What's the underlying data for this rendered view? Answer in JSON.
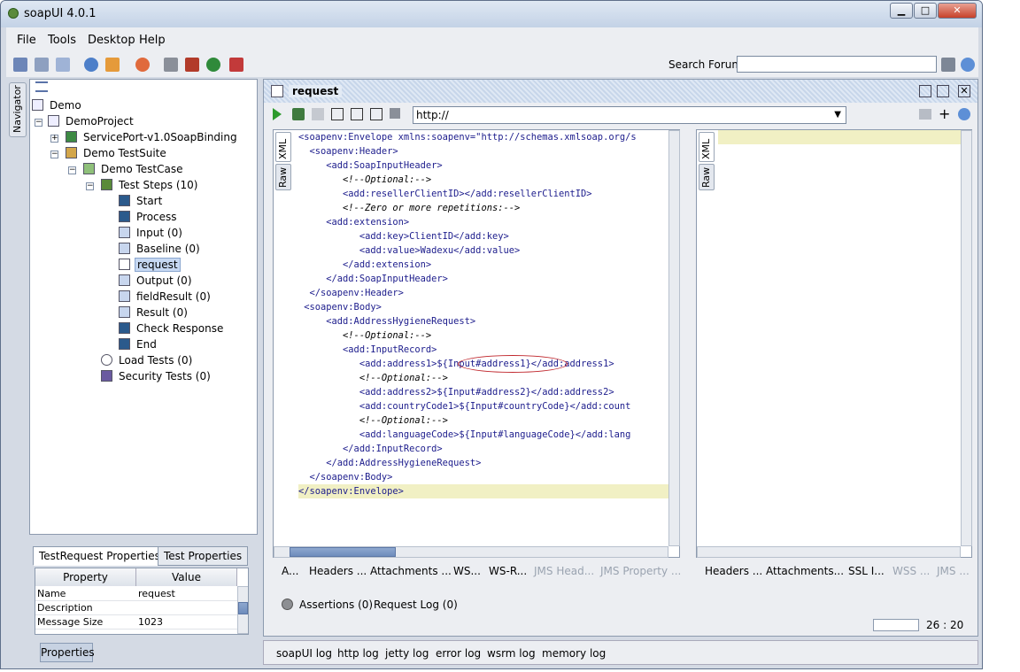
{
  "window": {
    "title": "soapUI 4.0.1",
    "min": "▁",
    "max": "□",
    "close": "✕"
  },
  "menu": [
    "File",
    "Tools",
    "Desktop",
    "Help"
  ],
  "toolbar": {
    "search_label": "Search Forum",
    "search_value": ""
  },
  "navigator_tab": "Navigator",
  "tree": [
    {
      "label": "Demo",
      "icon": "workspace-icon"
    },
    {
      "label": "DemoProject",
      "icon": "project-icon"
    },
    {
      "label": "ServicePort-v1.0SoapBinding",
      "icon": "interface-icon"
    },
    {
      "label": "Demo TestSuite",
      "icon": "testsuite-icon"
    },
    {
      "label": "Demo TestCase",
      "icon": "testcase-icon"
    },
    {
      "label": "Test Steps (10)",
      "icon": "teststeps-icon"
    },
    {
      "label": "Start",
      "icon": "star-icon"
    },
    {
      "label": "Process",
      "icon": "star-icon"
    },
    {
      "label": "Input (0)",
      "icon": "datasource-icon"
    },
    {
      "label": "Baseline (0)",
      "icon": "datasource-icon"
    },
    {
      "label": "request",
      "icon": "soap-request-icon"
    },
    {
      "label": "Output (0)",
      "icon": "datasource-icon"
    },
    {
      "label": "fieldResult (0)",
      "icon": "datasource-icon"
    },
    {
      "label": "Result (0)",
      "icon": "datasource-icon"
    },
    {
      "label": "Check Response",
      "icon": "star-icon"
    },
    {
      "label": "End",
      "icon": "star-icon"
    },
    {
      "label": "Load Tests (0)",
      "icon": "loadtest-icon"
    },
    {
      "label": "Security Tests (0)",
      "icon": "securitytest-icon"
    }
  ],
  "properties": {
    "tabs": [
      "TestRequest Properties",
      "Test Properties"
    ],
    "headers": [
      "Property",
      "Value"
    ],
    "rows": [
      {
        "name": "Name",
        "value": "request"
      },
      {
        "name": "Description",
        "value": ""
      },
      {
        "name": "Message Size",
        "value": "1023"
      }
    ],
    "button": "Properties"
  },
  "editor": {
    "title": "request",
    "endpoint": "http://",
    "request_tabs": [
      "XML",
      "Raw"
    ],
    "response_tabs": [
      "XML",
      "Raw"
    ],
    "xml_lines": [
      "<soapenv:Envelope xmlns:soapenv=\"http://schemas.xmlsoap.org/s",
      "  <soapenv:Header>",
      "     <add:SoapInputHeader>",
      "        <!--Optional:-->",
      "        <add:resellerClientID></add:resellerClientID>",
      "        <!--Zero or more repetitions:-->",
      "     <add:extension>",
      "           <add:key>ClientID</add:key>",
      "           <add:value>Wadexu</add:value>",
      "        </add:extension>",
      "     </add:SoapInputHeader>",
      "  </soapenv:Header>",
      " <soapenv:Body>",
      "     <add:AddressHygieneRequest>",
      "        <!--Optional:-->",
      "        <add:InputRecord>",
      "           <add:address1>${Input#address1}</add:address1>",
      "           <!--Optional:-->",
      "           <add:address2>${Input#address2}</add:address2>",
      "           <add:countryCode1>${Input#countryCode}</add:count",
      "           <!--Optional:-->",
      "           <add:languageCode>${Input#languageCode}</add:lang",
      "        </add:InputRecord>",
      "     </add:AddressHygieneRequest>",
      "  </soapenv:Body>",
      "</soapenv:Envelope>"
    ],
    "request_bottom_tabs": [
      "A...",
      "Headers ...",
      "Attachments ...",
      "WS...",
      "WS-R...",
      "JMS Head...",
      "JMS Property ..."
    ],
    "response_bottom_tabs": [
      "Headers ...",
      "Attachments...",
      "SSL I...",
      "WSS ...",
      "JMS ..."
    ],
    "assertions": "Assertions (0)",
    "request_log": "Request Log (0)",
    "cursor": "26 : 20"
  },
  "logs": [
    "soapUI log",
    "http log",
    "jetty log",
    "error log",
    "wsrm log",
    "memory log"
  ]
}
